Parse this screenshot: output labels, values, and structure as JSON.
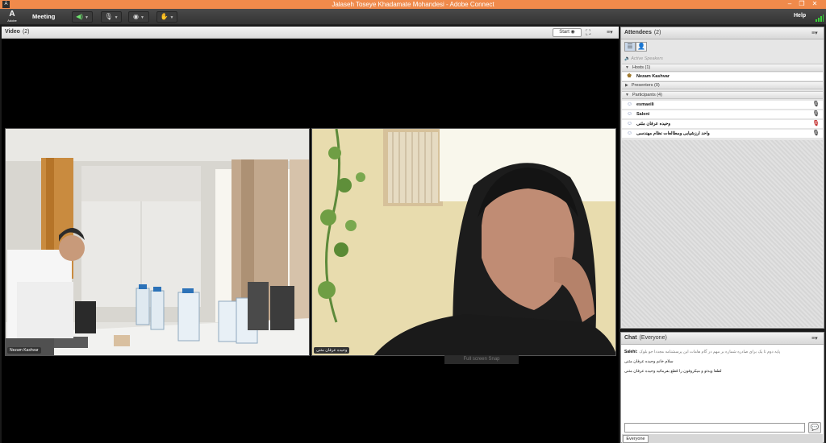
{
  "window": {
    "title": "Jalaseh Toseye Khadamate Mohandesi - Adobe Connect",
    "app_icon": "adobe-connect-icon",
    "controls": [
      "minimize-icon",
      "restore-icon",
      "close-icon"
    ],
    "accent": "#f08a4b"
  },
  "menubar": {
    "logo_mark": "A",
    "logo_word": "Adobe",
    "meeting_label": "Meeting",
    "help_label": "Help",
    "signal_color": "#39d439"
  },
  "video_pod": {
    "title": "Video",
    "count": "(2)",
    "start_label": "Start",
    "feeds": [
      {
        "label": "Nezam Kashvar"
      },
      {
        "label": "وحیده عرفان مثنی"
      }
    ],
    "fullscreen_tip": "Full screen Snap"
  },
  "attendees_pod": {
    "title": "Attendees",
    "count": "(2)",
    "active_speakers": "Active Speakers",
    "hosts_label": "Hosts (1)",
    "presenters_label": "Presenters (0)",
    "participants_label": "Participants (4)",
    "hosts": [
      {
        "name": "Nezam Kashvar"
      }
    ],
    "participants": [
      {
        "name": "esmaeili"
      },
      {
        "name": "Saleni"
      },
      {
        "name": "وحیده عرفان مثنی"
      },
      {
        "name": "واحد ارزشیابی ومطالعات نظام مهندسی"
      }
    ]
  },
  "chat_pod": {
    "title": "Chat",
    "scope": "(Everyone)",
    "messages": [
      {
        "sender": "Salehi:",
        "text": "پایه دوم تا یک برای صادره شماره بر مهم در گام هامات این پرسشنامه مجددا جو بلوک"
      },
      {
        "sender": "",
        "text": "سلام خانم وحیده عرفان مثنی"
      },
      {
        "sender": "",
        "text": "لطفا ویدئو و میکروفون را قطع بفرمائید وحیده عرفان مثنی"
      }
    ],
    "tab_label": "Everyone"
  }
}
